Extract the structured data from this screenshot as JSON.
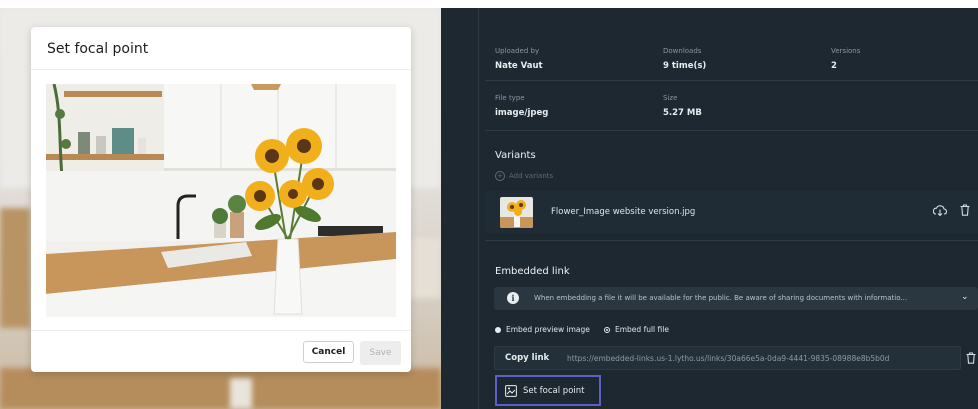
{
  "modal": {
    "title": "Set focal point",
    "cancel_label": "Cancel",
    "save_label": "Save"
  },
  "details": {
    "uploaded_by_label": "Uploaded by",
    "uploaded_by_value": "Nate Vaut",
    "downloads_label": "Downloads",
    "downloads_value": "9 time(s)",
    "versions_label": "Versions",
    "versions_value": "2",
    "file_type_label": "File type",
    "file_type_value": "image/jpeg",
    "size_label": "Size",
    "size_value": "5.27 MB"
  },
  "variants": {
    "title": "Variants",
    "add_label": "Add variants",
    "items": [
      {
        "name": "Flower_Image website version.jpg"
      }
    ]
  },
  "embedded": {
    "title": "Embedded link",
    "notice": "When embedding a file it will be available for the public. Be aware of sharing documents with informatio...",
    "option_preview": "Embed preview image",
    "option_full": "Embed full file",
    "copy_label": "Copy link",
    "url": "https://embedded-links.us-1.lytho.us/links/30a66e5a-0da9-4441-9835-08988e8b5b0d"
  },
  "focal_button_label": "Set focal point",
  "colors": {
    "panel_bg": "#1d2831",
    "accent_outline": "#5b5fc7",
    "modal_bg": "#ffffff"
  },
  "icons": [
    "plus-circle-icon",
    "download-icon",
    "trash-icon",
    "info-icon",
    "chevron-down-icon",
    "focal-point-icon"
  ]
}
